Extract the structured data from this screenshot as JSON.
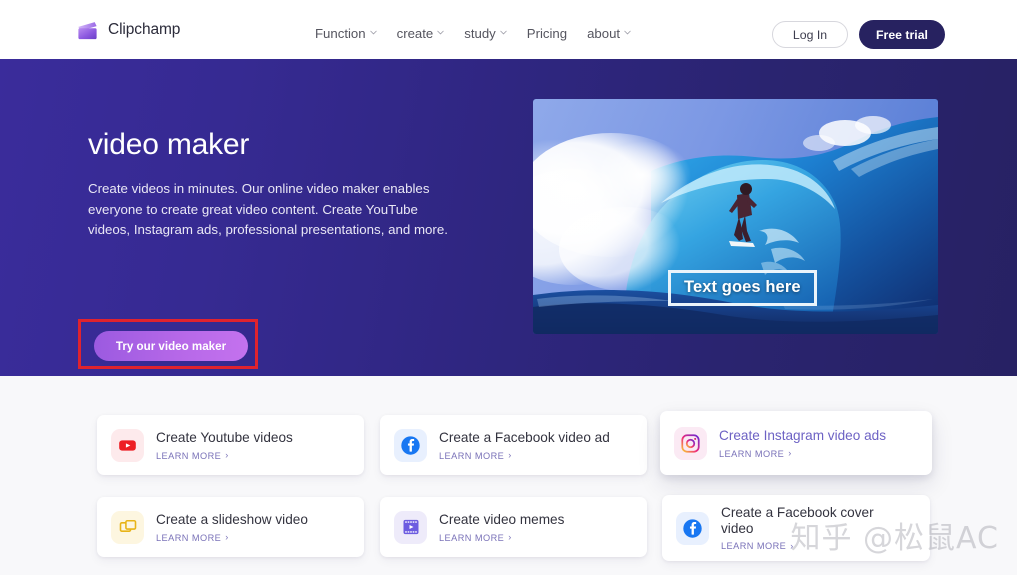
{
  "brand": {
    "name": "Clipchamp",
    "logo_icon": "clipchamp-logo-icon"
  },
  "nav": {
    "items": [
      {
        "label": "Function",
        "has_caret": true
      },
      {
        "label": "create",
        "has_caret": true
      },
      {
        "label": "study",
        "has_caret": true
      },
      {
        "label": "Pricing",
        "has_caret": false
      },
      {
        "label": "about",
        "has_caret": true
      }
    ],
    "login_label": "Log In",
    "trial_label": "Free trial"
  },
  "hero": {
    "title": "video maker",
    "subtitle": "Create videos in minutes. Our online video maker enables everyone to create great video content. Create YouTube videos, Instagram ads, professional presentations, and more.",
    "cta_label": "Try our video maker",
    "cta_highlight_color": "#e0232e",
    "media_overlay_text": "Text goes here",
    "media_alt": "surfer riding a large ocean wave"
  },
  "cards": [
    {
      "title": "Create Youtube videos",
      "learn_more": "LEARN MORE",
      "icon": "youtube-icon",
      "icon_class": "ic-youtube",
      "hovered": false,
      "title_hover": false,
      "two_line": false
    },
    {
      "title": "Create a Facebook video ad",
      "learn_more": "LEARN MORE",
      "icon": "facebook-icon",
      "icon_class": "ic-facebook",
      "hovered": false,
      "title_hover": false,
      "two_line": false
    },
    {
      "title": "Create Instagram video ads",
      "learn_more": "LEARN MORE",
      "icon": "instagram-icon",
      "icon_class": "ic-instagram",
      "hovered": true,
      "title_hover": true,
      "two_line": false
    },
    {
      "title": "Create a slideshow video",
      "learn_more": "LEARN MORE",
      "icon": "slideshow-icon",
      "icon_class": "ic-slideshow",
      "hovered": false,
      "title_hover": false,
      "two_line": false
    },
    {
      "title": "Create video memes",
      "learn_more": "LEARN MORE",
      "icon": "film-strip-icon",
      "icon_class": "ic-memes",
      "hovered": false,
      "title_hover": false,
      "two_line": false
    },
    {
      "title": "Create a Facebook cover video",
      "learn_more": "LEARN MORE",
      "icon": "facebook-icon",
      "icon_class": "ic-facebook",
      "hovered": false,
      "title_hover": false,
      "two_line": true
    }
  ],
  "watermark": {
    "text": "知乎 @松鼠AC"
  },
  "arrow_glyph": "›",
  "colors": {
    "brand_purple": "#9b5ae0",
    "hero_gradient_start": "#3a2c9b",
    "hero_gradient_end": "#272163",
    "trial_button": "#272260",
    "highlight_red": "#e0232e",
    "link_purple": "#7a72b8",
    "page_bg": "#f8f8fa"
  }
}
